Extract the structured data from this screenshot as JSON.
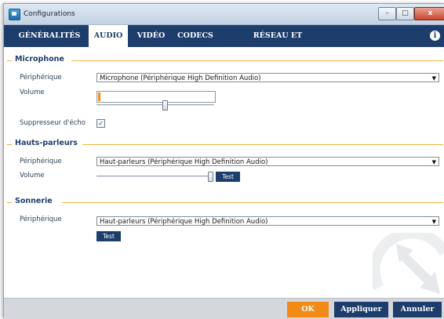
{
  "window": {
    "title": "Configurations",
    "controls": {
      "minimize": "–",
      "maximize": "□",
      "close": "x"
    }
  },
  "tabs": [
    {
      "label": "GÉNÉRALITÉS",
      "active": false
    },
    {
      "label": "AUDIO",
      "active": true
    },
    {
      "label": "VIDÉO",
      "active": false
    },
    {
      "label": "CODECS",
      "active": false
    },
    {
      "label": "RÉSEAU ET PROTOCOLES",
      "active": false
    }
  ],
  "info_icon": "i",
  "microphone": {
    "title": "Microphone",
    "device_label": "Périphérique",
    "device_value": "Microphone (Périphérique High Definition Audio)",
    "volume_label": "Volume",
    "volume_level": 0.01,
    "slider_position": 0.58,
    "echo_label": "Suppresseur d'écho",
    "echo_checked": true,
    "check_glyph": "✓"
  },
  "speakers": {
    "title": "Hauts-parleurs",
    "device_label": "Périphérique",
    "device_value": "Haut-parleurs (Périphérique High Definition Audio)",
    "volume_label": "Volume",
    "slider_position": 0.98,
    "test_label": "Test"
  },
  "ringer": {
    "title": "Sonnerie",
    "device_label": "Périphérique",
    "device_value": "Haut-parleurs (Périphérique High Definition Audio)",
    "test_label": "Test"
  },
  "footer": {
    "ok": "OK",
    "apply": "Appliquer",
    "cancel": "Annuler"
  },
  "caret_glyph": "▼",
  "colors": {
    "accent_navy": "#1d3e6c",
    "accent_orange": "#f28b16",
    "section_line": "#f0b23f"
  }
}
